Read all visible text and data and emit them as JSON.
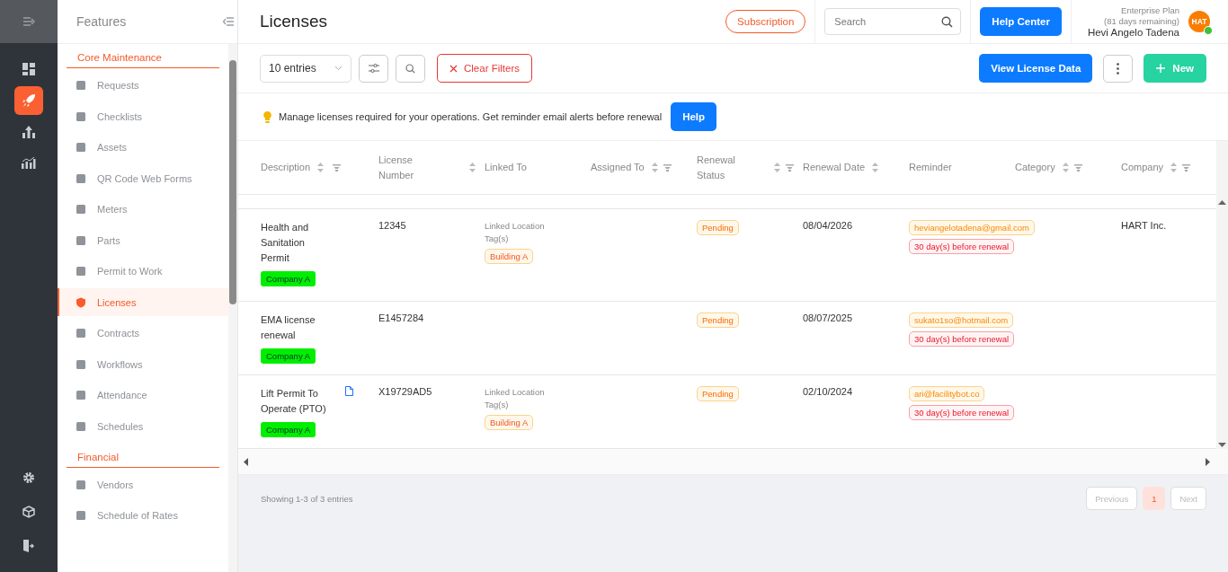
{
  "sidebar": {
    "title": "Features",
    "sections": [
      {
        "title": "Core Maintenance",
        "items": [
          {
            "label": "Requests",
            "selected": false
          },
          {
            "label": "Checklists",
            "selected": false
          },
          {
            "label": "Assets",
            "selected": false
          },
          {
            "label": "QR Code Web Forms",
            "selected": false
          },
          {
            "label": "Meters",
            "selected": false
          },
          {
            "label": "Parts",
            "selected": false
          },
          {
            "label": "Permit to Work",
            "selected": false
          },
          {
            "label": "Licenses",
            "selected": true
          },
          {
            "label": "Contracts",
            "selected": false
          },
          {
            "label": "Workflows",
            "selected": false
          },
          {
            "label": "Attendance",
            "selected": false
          },
          {
            "label": "Schedules",
            "selected": false
          }
        ]
      },
      {
        "title": "Financial",
        "items": [
          {
            "label": "Vendors",
            "selected": false
          },
          {
            "label": "Schedule of Rates",
            "selected": false
          }
        ]
      }
    ]
  },
  "header": {
    "title": "Licenses",
    "subscription": "Subscription",
    "search": {
      "placeholder": "Search"
    },
    "help_center": "Help Center",
    "plan": "Enterprise Plan",
    "plan_remaining": "(81 days remaining)",
    "user": "Hevi Angelo Tadena",
    "avatar": "HAT",
    "online": true
  },
  "toolbar": {
    "entries": "10 entries",
    "clear_filters": "Clear Filters",
    "view_data": "View License Data",
    "new": "New"
  },
  "info": {
    "text": "Manage licenses required for your operations. Get reminder email alerts before renewal",
    "help": "Help"
  },
  "table": {
    "columns": [
      {
        "label": "Description",
        "sortable": true,
        "filterable": true
      },
      {
        "label": "License Number",
        "sortable": true,
        "filterable": false
      },
      {
        "label": "Linked To",
        "sortable": false,
        "filterable": false
      },
      {
        "label": "Assigned To",
        "sortable": true,
        "filterable": true
      },
      {
        "label": "Renewal Status",
        "sortable": true,
        "filterable": true
      },
      {
        "label": "Renewal Date",
        "sortable": true,
        "filterable": false
      },
      {
        "label": "Reminder",
        "sortable": false,
        "filterable": false
      },
      {
        "label": "Category",
        "sortable": true,
        "filterable": true
      },
      {
        "label": "Company",
        "sortable": true,
        "filterable": true
      }
    ],
    "rows": [
      {
        "description": "Health and Sanitation Permit",
        "document": false,
        "company_tag": "Company A",
        "license_number": "12345",
        "linked_label": "Linked Location Tag(s)",
        "linked_tag": "Building A",
        "status": "Pending",
        "renewal_date": "08/04/2026",
        "reminder_email": "heviangelotadena@gmail.com",
        "reminder_rule": "30 day(s) before renewal",
        "company": "HART Inc."
      },
      {
        "description": "EMA license renewal",
        "document": false,
        "company_tag": "Company A",
        "license_number": "E1457284",
        "status": "Pending",
        "renewal_date": "08/07/2025",
        "reminder_email": "sukato1so@hotmail.com",
        "reminder_rule": "30 day(s) before renewal"
      },
      {
        "description": "Lift Permit To Operate (PTO)",
        "document": true,
        "company_tag": "Company A",
        "license_number": "X19729AD5",
        "linked_label": "Linked Location Tag(s)",
        "linked_tag": "Building A",
        "status": "Pending",
        "renewal_date": "02/10/2024",
        "reminder_email": "ari@facilitybot.co",
        "reminder_rule": "30 day(s) before renewal"
      }
    ]
  },
  "footer": {
    "showing": "Showing 1-3 of 3 entries",
    "pages": [
      {
        "label": "1",
        "selected": true
      }
    ],
    "previous": "Previous",
    "next": "Next"
  }
}
